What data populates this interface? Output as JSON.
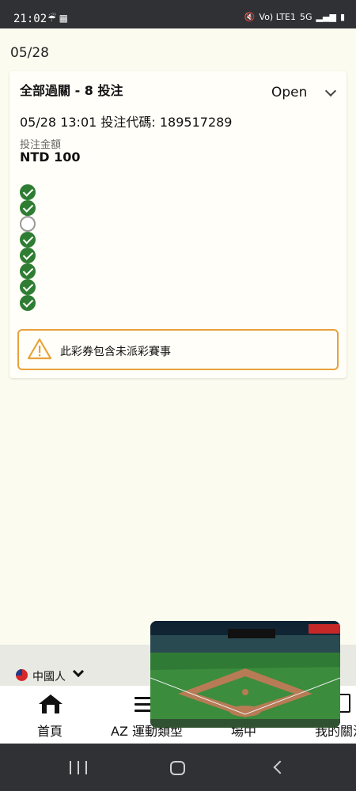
{
  "status_bar": {
    "time": "21:02",
    "left_icons": "☔ ▦",
    "network": "Vo) LTE1",
    "network_type": "5G"
  },
  "date_header": "05/28",
  "bet_card": {
    "title": "全部過關 - 8 投注",
    "status": "Open",
    "meta": "05/28 13:01 投注代碼: 189517289",
    "amount_label": "投注金額",
    "amount_value": "NTD 100",
    "legs": [
      "win",
      "win",
      "pending",
      "win",
      "win",
      "win",
      "win",
      "win"
    ],
    "warning_text": "此彩券包含未派彩賽事"
  },
  "language": {
    "label": "中國人"
  },
  "bottom_nav": {
    "home": "首頁",
    "sports": "AZ 運動類型",
    "live": "場中",
    "my": "我的關注"
  },
  "colors": {
    "win": "#2e7d32",
    "warning": "#e8a23a",
    "background": "#fcfbf0"
  }
}
